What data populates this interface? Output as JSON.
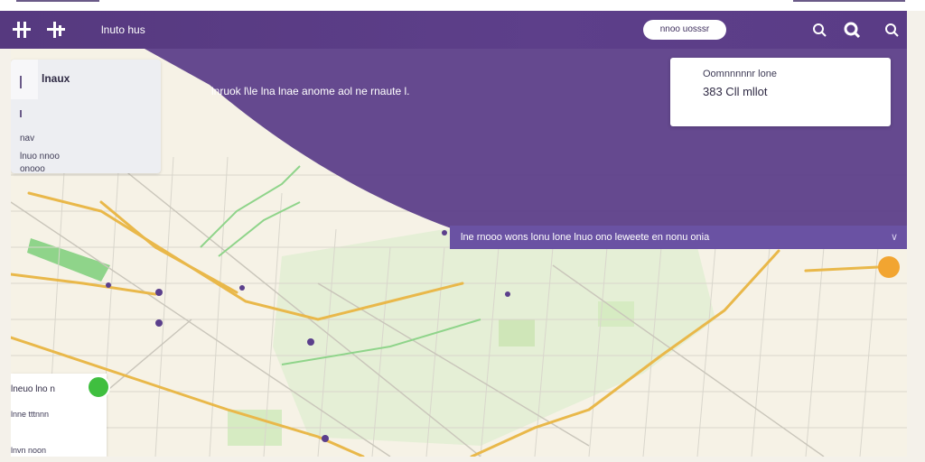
{
  "header": {
    "brand": "lnuto hus",
    "pill_label": "nnoo uosssr",
    "icons": [
      "search-icon",
      "search-icon",
      "search-icon"
    ]
  },
  "hero": {
    "text": "lnruok  l\\le lna lnae anome aol ne rnaute l."
  },
  "banner": {
    "text": "lne rnooo wons lonu lone lnuo ono leweete en nonu onia",
    "chevron": "chevron-down-icon"
  },
  "left_panel": {
    "title": "lnaux",
    "line1": "nav",
    "line2": "lnuo nnoo",
    "line3": "onooo"
  },
  "stat_card": {
    "label": "Oomnnnnnr lone",
    "value": "383 Cll  mllot"
  },
  "info_card": {
    "line1": "lneuo lno  n",
    "line2": "lnne tttnnn",
    "line3": "lnvn noon"
  },
  "colors": {
    "header": "#5a3c86",
    "banner": "#6a52a3",
    "road_major": "#e9b84a",
    "park": "#8fd48a",
    "pin_green": "#3fbf3f",
    "pin_orange": "#f2a531"
  }
}
